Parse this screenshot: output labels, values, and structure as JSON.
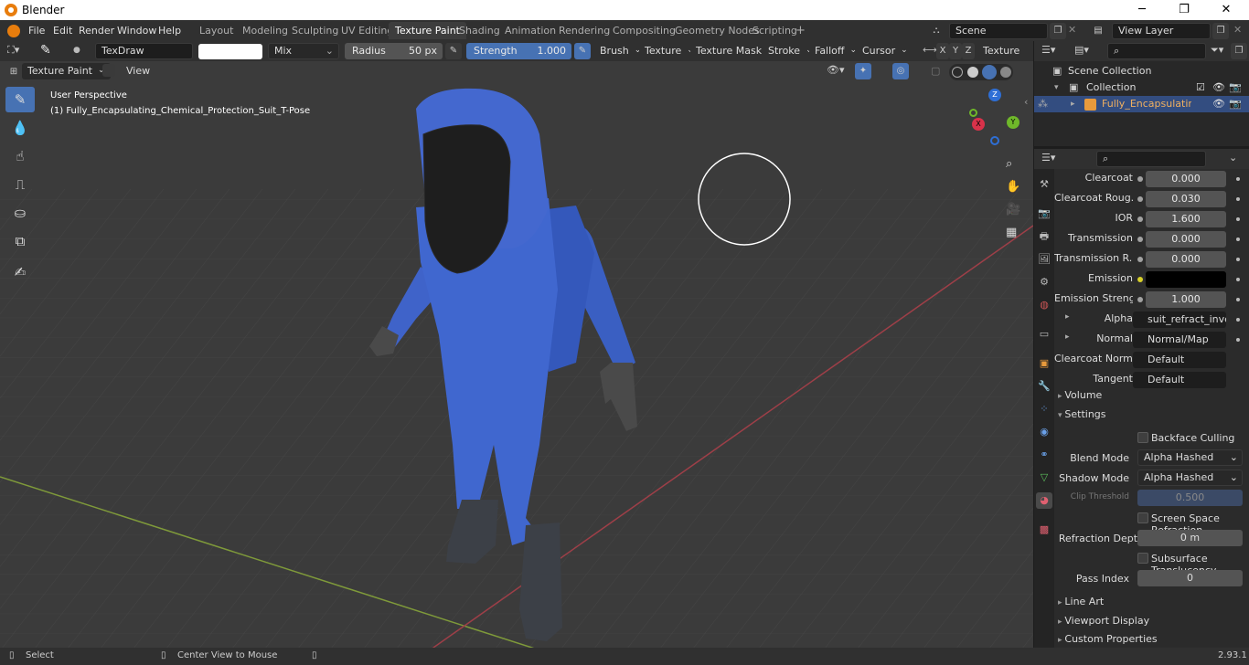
{
  "window": {
    "title": "Blender",
    "min": "─",
    "max": "❐",
    "close": "✕"
  },
  "menu": [
    "File",
    "Edit",
    "Render",
    "Window",
    "Help"
  ],
  "workspaces": [
    "Layout",
    "Modeling",
    "Sculpting",
    "UV Editing",
    "Texture Paint",
    "Shading",
    "Animation",
    "Rendering",
    "Compositing",
    "Geometry Nodes",
    "Scripting"
  ],
  "active_workspace": "Texture Paint",
  "scene": {
    "name": "Scene",
    "view_layer": "View Layer"
  },
  "toolheader": {
    "brush": "TexDraw",
    "blend": "Mix",
    "radius_label": "Radius",
    "radius_value": "50 px",
    "strength_label": "Strength",
    "strength_value": "1.000",
    "menus": [
      "Brush",
      "Texture",
      "Texture Mask",
      "Stroke",
      "Falloff",
      "Cursor"
    ],
    "axes": [
      "X",
      "Y",
      "Z"
    ],
    "texture_slots": "Texture Slots"
  },
  "viewheader": {
    "mode": "Texture Paint",
    "view": "View"
  },
  "viewport": {
    "perspective": "User Perspective",
    "object": "(1) Fully_Encapsulating_Chemical_Protection_Suit_T-Pose",
    "suit_color": "#3f63c9"
  },
  "gizmo": {
    "z": "Z",
    "y": "Y",
    "x": "X"
  },
  "outliner": {
    "root": "Scene Collection",
    "collection": "Collection",
    "object": "Fully_Encapsulating_Che"
  },
  "properties": {
    "rows": [
      {
        "label": "Clearcoat",
        "value": "0.000",
        "kind": "num"
      },
      {
        "label": "Clearcoat Roug...",
        "value": "0.030",
        "kind": "num"
      },
      {
        "label": "IOR",
        "value": "1.600",
        "kind": "num"
      },
      {
        "label": "Transmission",
        "value": "0.000",
        "kind": "num"
      },
      {
        "label": "Transmission R...",
        "value": "0.000",
        "kind": "num"
      },
      {
        "label": "Emission",
        "value": "",
        "kind": "color"
      },
      {
        "label": "Emission Streng...",
        "value": "1.000",
        "kind": "num"
      },
      {
        "label": "Alpha",
        "value": "suit_refract_invert.pn",
        "kind": "link"
      },
      {
        "label": "Normal",
        "value": "Normal/Map",
        "kind": "link"
      },
      {
        "label": "Clearcoat Normal",
        "value": "Default",
        "kind": "link"
      },
      {
        "label": "Tangent",
        "value": "Default",
        "kind": "link"
      }
    ],
    "volume": "Volume",
    "settings": "Settings",
    "backface": "Backface Culling",
    "blend_mode_label": "Blend Mode",
    "blend_mode": "Alpha Hashed",
    "shadow_mode_label": "Shadow Mode",
    "shadow_mode": "Alpha Hashed",
    "clip_label": "Clip Threshold",
    "clip_value": "0.500",
    "ssr": "Screen Space Refraction",
    "refr_label": "Refraction Depth",
    "refr_value": "0 m",
    "sss": "Subsurface Translucency",
    "pass_label": "Pass Index",
    "pass_value": "0",
    "line_art": "Line Art",
    "viewport_display": "Viewport Display",
    "custom_props": "Custom Properties"
  },
  "status": {
    "select": "Select",
    "center": "Center View to Mouse",
    "version": "2.93.1"
  }
}
